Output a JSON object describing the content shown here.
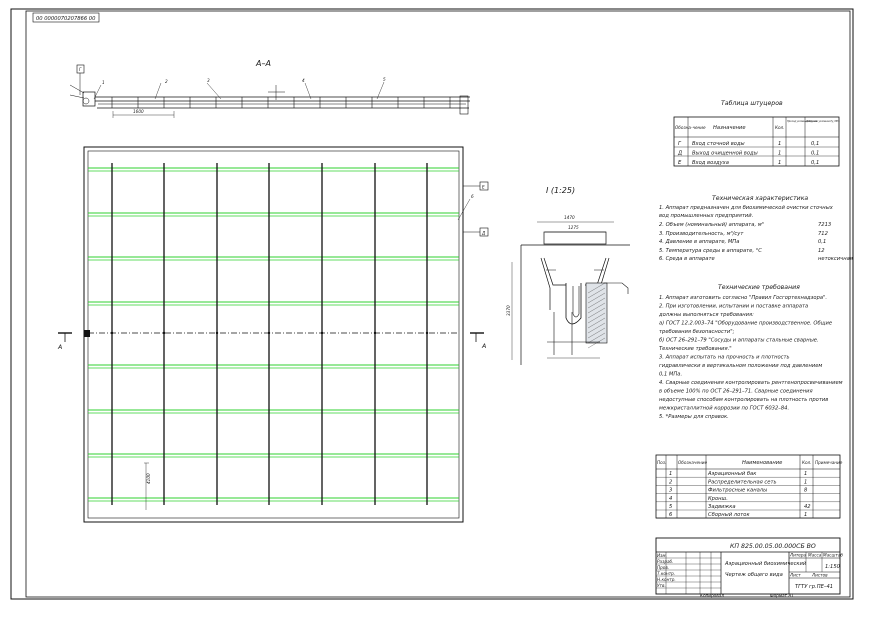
{
  "stamp_top": "00 0000070207866 00",
  "section_label": "А–А",
  "detail_label": "I (1:25)",
  "cut_marks": {
    "left": "А",
    "right": "А"
  },
  "callouts_top": [
    "1",
    "2",
    "3",
    "4",
    "5"
  ],
  "callout_6": "6",
  "dims": {
    "plan_vertical": "4100",
    "detail_top_outer": "1470",
    "detail_top_inner": "1275",
    "detail_height": "3370",
    "section_span": "1600"
  },
  "flag_letters": {
    "g": "Г",
    "d": "Д",
    "e": "Е"
  },
  "fittings_table": {
    "title": "Таблица штуцеров",
    "headers": [
      "Обозна-чение",
      "Назначение",
      "Кол.",
      "Проход условный Dy, мм",
      "Давление условное Py, МПа"
    ],
    "rows": [
      [
        "Г",
        "Вход сточной воды",
        "1",
        "",
        "0,1"
      ],
      [
        "Д",
        "Выход очищенной воды",
        "1",
        "",
        "0,1"
      ],
      [
        "Е",
        "Вход воздуха",
        "1",
        "",
        "0,1"
      ]
    ]
  },
  "characteristics": {
    "title": "Техническая характеристика",
    "lines": [
      "1. Аппарат предназначен для биохимической очистки сточных",
      "вод промышленных предприятий.",
      "2. Объем (номинальный) аппарата, м³",
      "3. Производительность, м³/сут",
      "4. Давление в аппарате, МПа",
      "5. Температура среды в аппарате, °С",
      "6. Среда в аппарате"
    ],
    "values": [
      "7213",
      "712",
      "0,1",
      "12",
      "нетоксичная"
    ]
  },
  "requirements": {
    "title": "Технические требования",
    "lines": [
      "1. Аппарат изготовить согласно \"Правил Госгортехнадзора\".",
      "2. При изготовлении, испытании и поставке аппарата",
      "должны выполняться требования:",
      "а) ГОСТ 12.2.003–74 \"Оборудование производственное. Общие",
      "требования безопасности\";",
      "б) ОСТ 26–291–79 \"Сосуды и аппараты стальные сварные.",
      "Технические требования.\"",
      "3. Аппарат испытать на прочность и плотность",
      "гидравлически в вертикальном положении под давлением",
      "0,1 МПа.",
      "4. Сварные соединения контролировать рентгенопросвечиванием",
      "в объеме 100% по ОСТ 26–291–71. Сварные соединения",
      "недоступные способам контролировать на плотность против",
      "межкристаллитной коррозии по ГОСТ 6032–84.",
      "5. *Размеры для справок."
    ]
  },
  "parts_list": {
    "headers": [
      "Поз.",
      "Обозначение",
      "Наименование",
      "Кол.",
      "Примечание"
    ],
    "rows": [
      [
        "1",
        "",
        "Аэрационный бак",
        "1",
        ""
      ],
      [
        "2",
        "",
        "Распределительная сеть",
        "1",
        ""
      ],
      [
        "3",
        "",
        "Фильтросные каналы",
        "8",
        ""
      ],
      [
        "4",
        "",
        "Кронш.",
        "",
        ""
      ],
      [
        "5",
        "",
        "Задвижка",
        "42",
        ""
      ],
      [
        "6",
        "",
        "Сборный лоток",
        "1",
        ""
      ]
    ]
  },
  "title_block": {
    "code": "КП 825.00.05.00.000СБ ВО",
    "name_line1": "Аэрационный биохимический",
    "name_line2": "Чертеж общего вида",
    "scale": "1:150",
    "org": "ТГТУ гр.ПЕ–41",
    "col_headers": [
      "Литера",
      "Масса",
      "Масштаб"
    ],
    "sheet_labels": [
      "Лист",
      "Листов"
    ],
    "sign_rows": [
      "Изм.",
      "Разраб.",
      "Пров.",
      "Т.контр.",
      "Н.контр.",
      "Утв."
    ]
  },
  "footer": {
    "left": "Копировал",
    "right": "Формат А1"
  }
}
